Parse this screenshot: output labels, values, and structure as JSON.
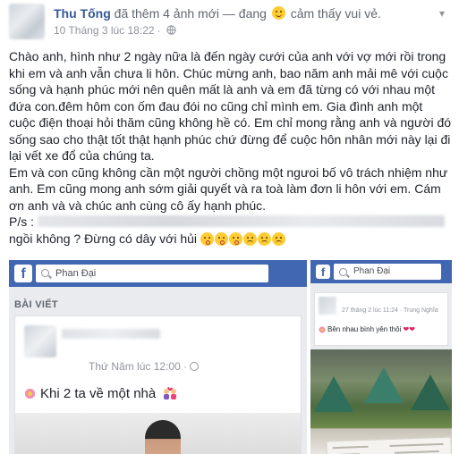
{
  "post": {
    "author": "Thu Tống",
    "action": "đã thêm 4 ảnh mới — đang",
    "feeling": "cảm thấy vui vẻ.",
    "timestamp": "10 Tháng 3 lúc 18:22",
    "privacy_icon": "globe-icon",
    "paragraphs": [
      "Chào anh, hình như 2 ngày nữa là đến ngày cưới của anh với vợ mới rồi trong khi em và anh vẫn chưa li hôn. Chúc mừng anh, bao năm anh mải mê với cuộc sống và hạnh phúc mới nên quên mất là anh và em đã từng có với nhau một đứa con.đêm hôm con ốm đau đói no cũng chỉ mình em. Gia đình anh một cuộc điện thoại hỏi thăm cũng không hề có. Em chỉ mong rằng anh và người đó sống sao cho thật tốt thật hạnh phúc chứ đừng để cuộc hôn nhân mới này lại đi lại vết xe đổ của chúng ta.",
      "Em và con cũng không cần một người chồng một ngưoi bố vô trách nhiệm như anh. Em cũng mong anh sớm giải quyết và ra toà làm đơn li hôn với em. Cám ơn anh và và chúc anh cùng cô ấy hạnh phúc."
    ],
    "ps_label": "P/s :",
    "ps_tail": "ngồi không ? Đừng có dây với hủi"
  },
  "screenshot_left": {
    "search_text": "Phan Đại",
    "section_label": "BÀI VIẾT",
    "time": "Thứ Năm lúc 12:00 ·",
    "status": "Khi 2 ta về một nhà"
  },
  "screenshot_right": {
    "search_text": "Phan Đại",
    "time": "27 tháng 2 lúc 11:24 · Trung Nghĩa",
    "status": "Bên nhau bình yên thôi"
  },
  "colors": {
    "link": "#365899",
    "muted": "#90949c",
    "fb_blue": "#4267b2"
  }
}
